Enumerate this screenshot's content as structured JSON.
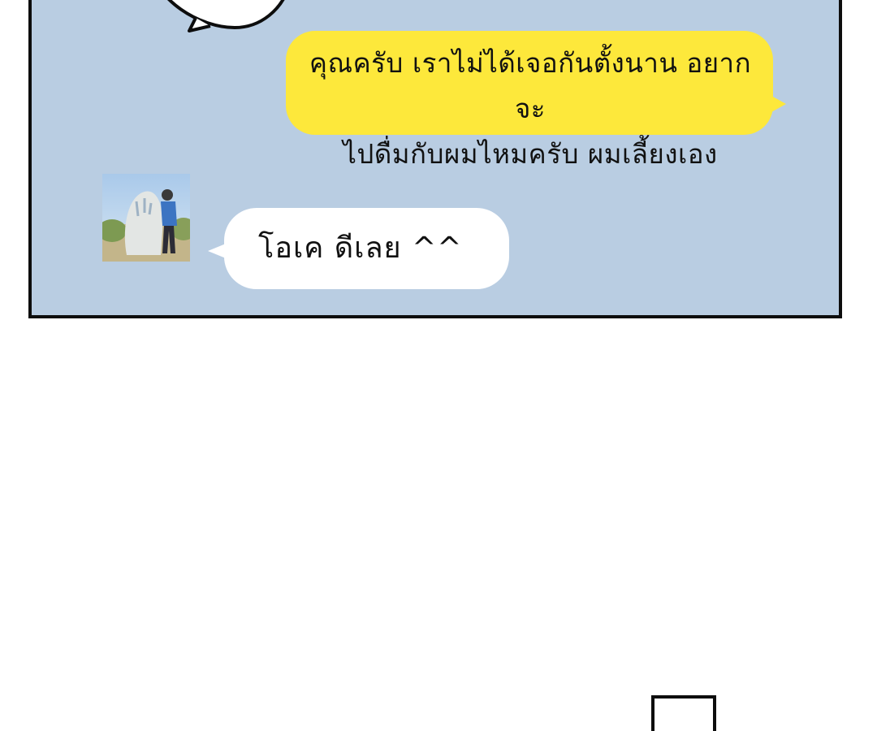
{
  "messages": {
    "outgoing": {
      "line1": "คุณครับ เราไม่ได้เจอกันตั้งนาน อยากจะ",
      "line2": "ไปดื่มกับผมไหมครับ ผมเลี้ยงเอง"
    },
    "incoming": {
      "text": "โอเค ดีเลย ^^"
    }
  },
  "colors": {
    "chat_background": "#b9cde2",
    "outgoing_bubble": "#fde83b",
    "incoming_bubble": "#ffffff",
    "panel_border": "#0d0d0d"
  },
  "avatar": {
    "icon": "profile-photo-person-beside-stone"
  }
}
